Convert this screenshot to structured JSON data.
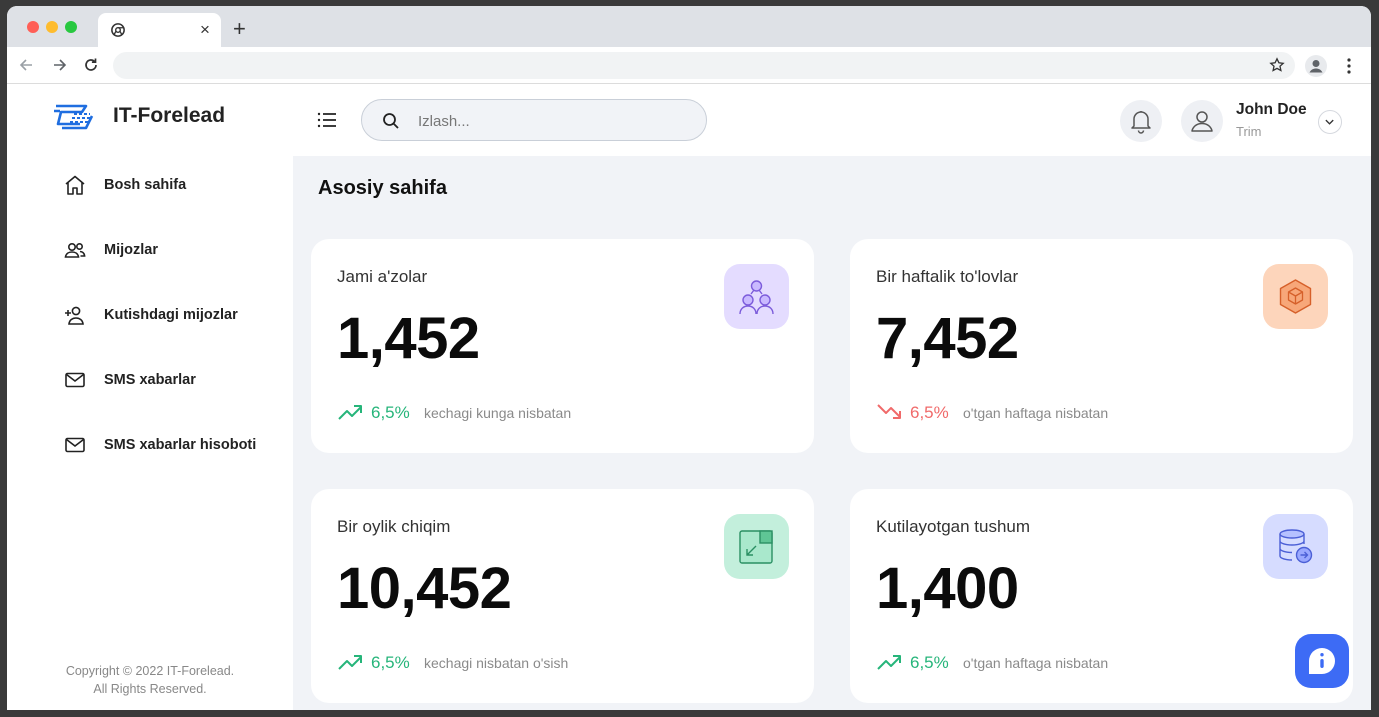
{
  "browser": {
    "tab": {
      "title": "",
      "icon": "chrome-icon"
    },
    "omnibox": {
      "url": ""
    },
    "colors": {
      "close": "#ff5f57",
      "minimize": "#febc2e",
      "maximize": "#28c840"
    }
  },
  "sidebar": {
    "brand": "IT-Forelead",
    "items": [
      {
        "label": "Bosh sahifa",
        "icon": "home-icon"
      },
      {
        "label": "Mijozlar",
        "icon": "users-icon"
      },
      {
        "label": "Kutishdagi mijozlar",
        "icon": "add-user-icon"
      },
      {
        "label": "SMS xabarlar",
        "icon": "mail-icon"
      },
      {
        "label": "SMS xabarlar hisoboti",
        "icon": "mail-icon"
      }
    ],
    "copyright_line1": "Copyright © 2022 IT-Forelead.",
    "copyright_line2": "All Rights Reserved."
  },
  "header": {
    "search_placeholder": "Izlash...",
    "user": {
      "name": "John Doe",
      "role": "Trim"
    }
  },
  "main": {
    "page_title": "Asosiy sahifa",
    "cards": [
      {
        "title": "Jami a'zolar",
        "value": "1,452",
        "trend_pct": "6,5%",
        "trend_note": "kechagi kunga nisbatan",
        "trend": "up",
        "icon": "team-icon",
        "badge_color": "#e4dcff"
      },
      {
        "title": "Bir haftalik to'lovlar",
        "value": "7,452",
        "trend_pct": "6,5%",
        "trend_note": "o'tgan haftaga nisbatan",
        "trend": "down",
        "icon": "box-icon",
        "badge_color": "#fdd5bb"
      },
      {
        "title": "Bir oylik chiqim",
        "value": "10,452",
        "trend_pct": "6,5%",
        "trend_note": "kechagi nisbatan o'sish",
        "trend": "up",
        "icon": "expand-icon",
        "badge_color": "#c3efdc"
      },
      {
        "title": "Kutilayotgan tushum",
        "value": "1,400",
        "trend_pct": "6,5%",
        "trend_note": "o'tgan haftaga nisbatan",
        "trend": "up",
        "icon": "database-icon",
        "badge_color": "#d6dcff"
      }
    ]
  },
  "colors": {
    "up": "#26b57a",
    "down": "#f06a6a",
    "accent": "#3d6bf5",
    "background": "#f1f3f7"
  }
}
